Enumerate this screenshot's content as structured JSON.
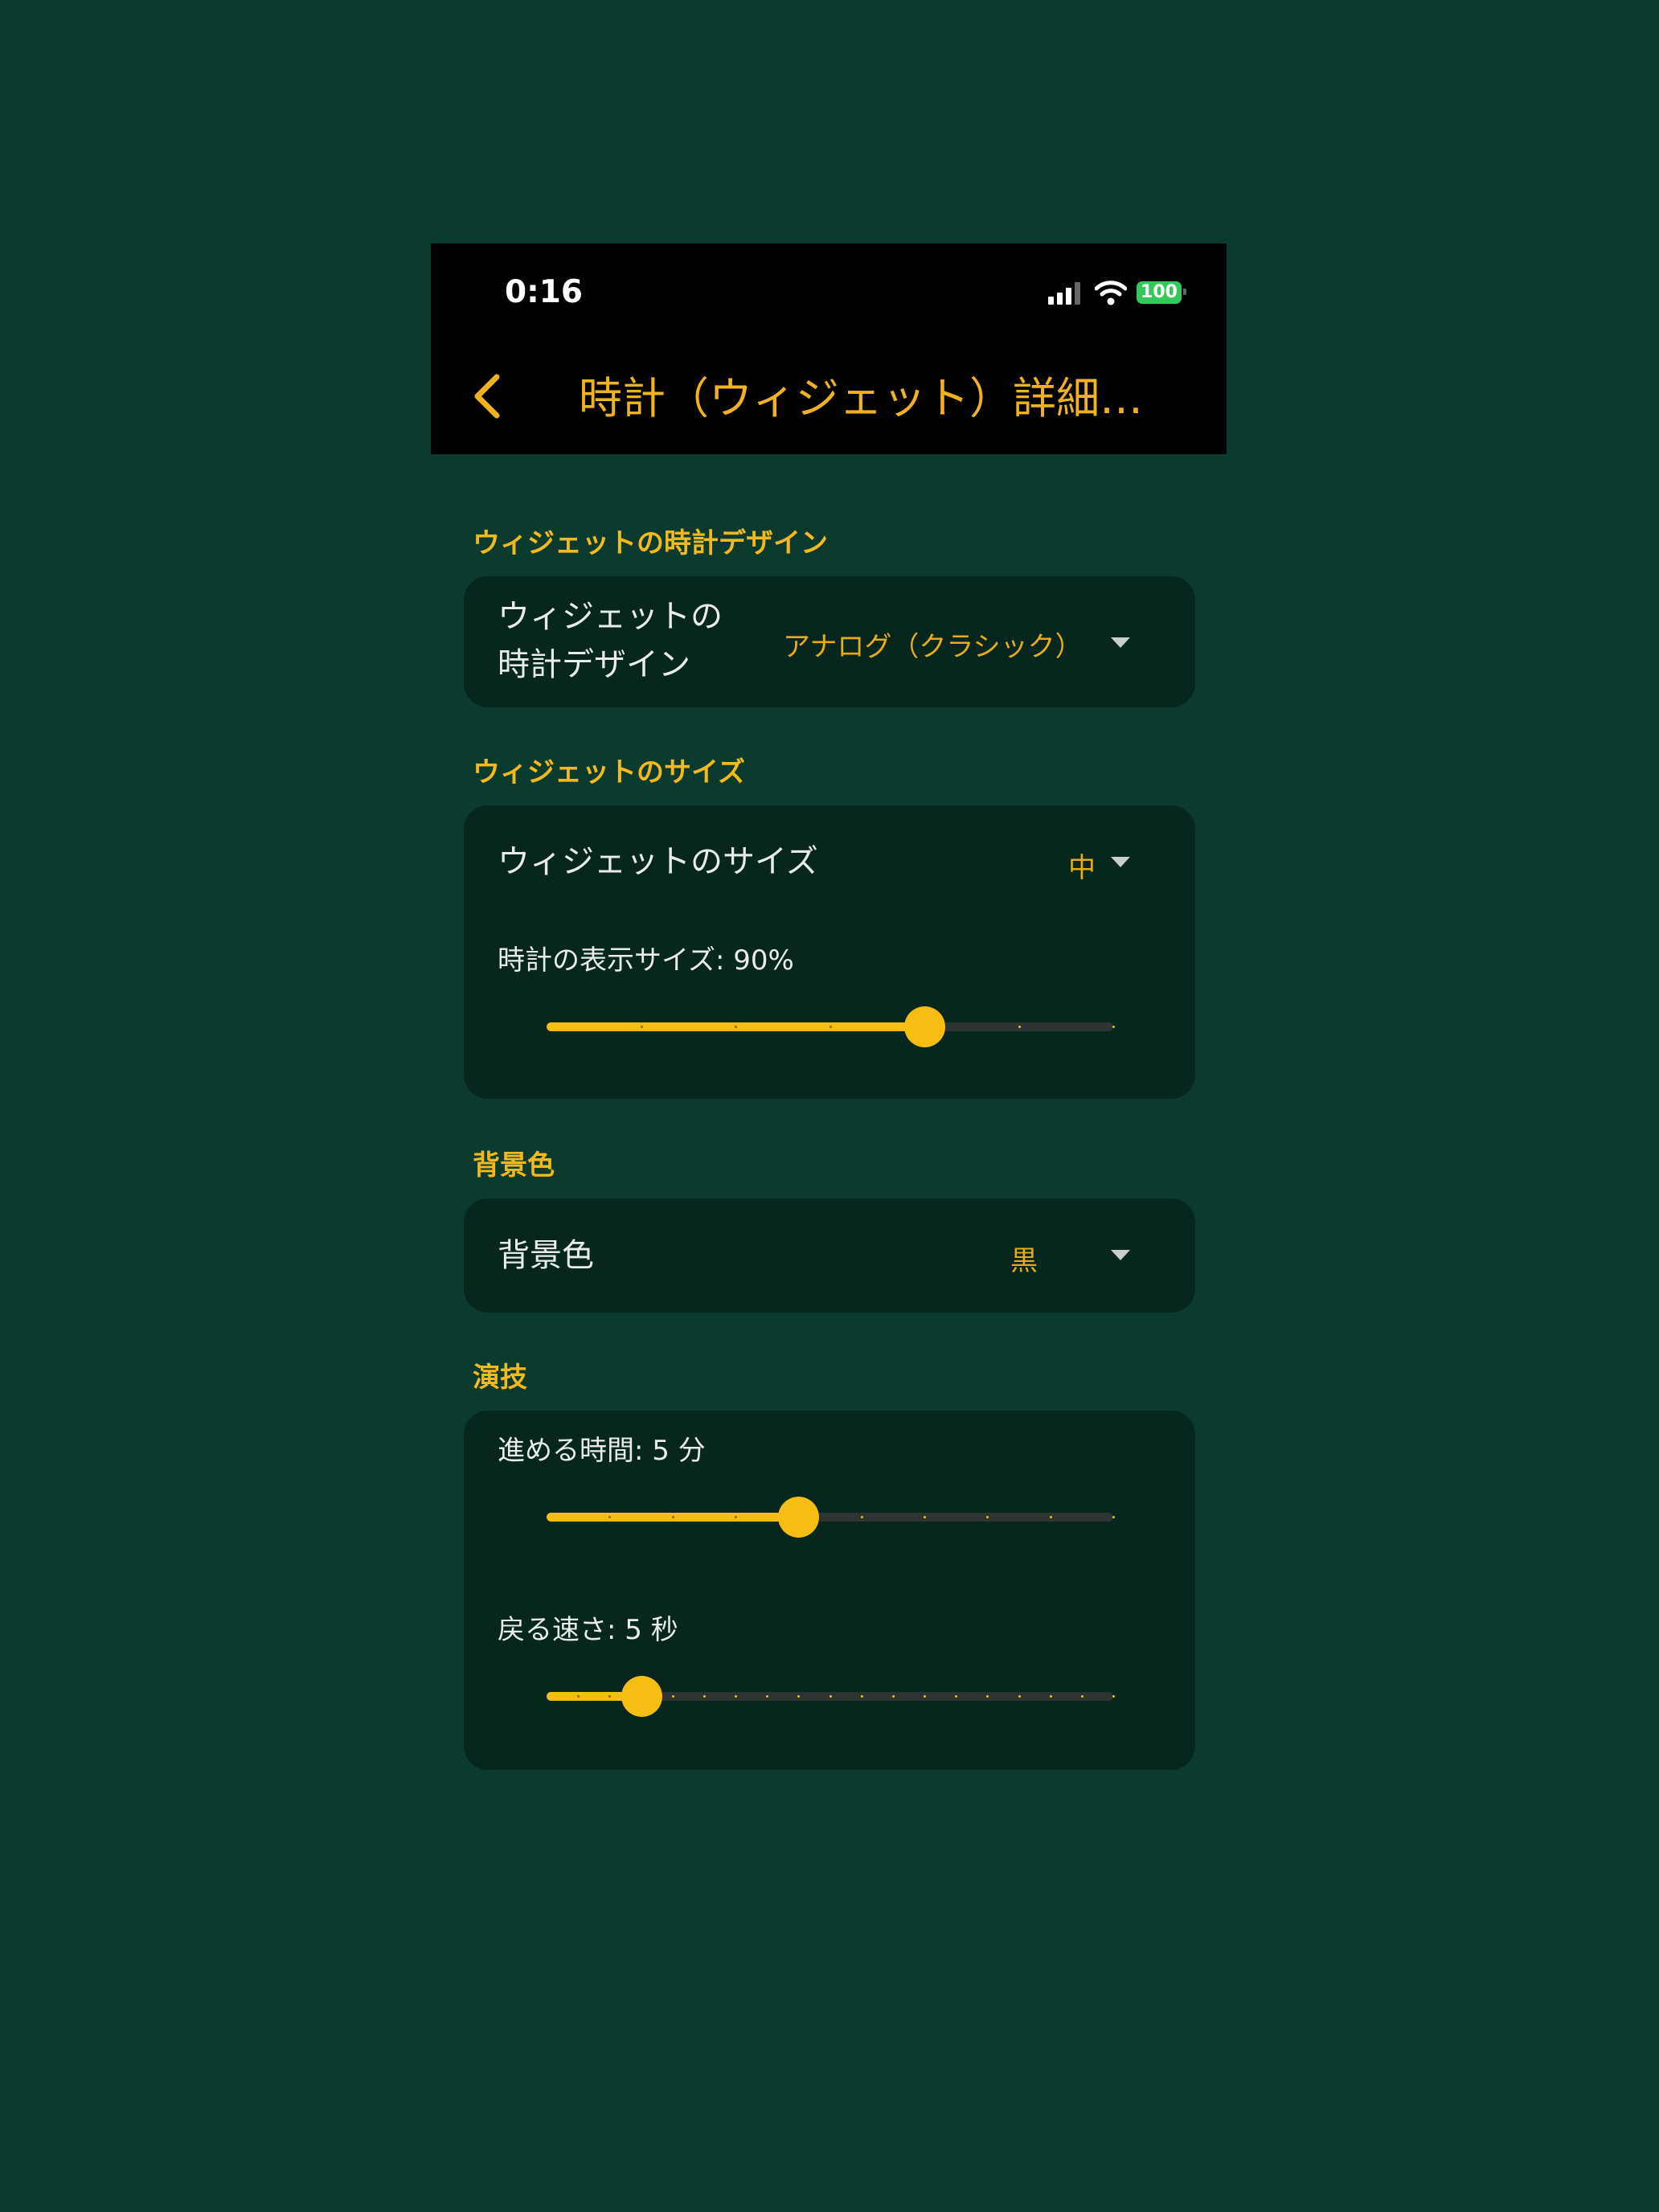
{
  "status_bar": {
    "time": "0:16",
    "battery": "100"
  },
  "nav": {
    "title": "時計（ウィジェット）詳細…",
    "back_icon": "chevron-left-icon"
  },
  "sections": {
    "design": {
      "title": "ウィジェットの時計デザイン",
      "label_line1": "ウィジェットの",
      "label_line2": "時計デザイン",
      "value": "アナログ（クラシック）"
    },
    "size": {
      "title": "ウィジェットのサイズ",
      "label": "ウィジェットのサイズ",
      "value": "中",
      "slider_label": "時計の表示サイズ: 90%",
      "slider": {
        "value": 0.667,
        "ticks": 6
      }
    },
    "background": {
      "title": "背景色",
      "label": "背景色",
      "value": "黒"
    },
    "performance": {
      "title": "演技",
      "advance_label": "進める時間: 5 分",
      "advance_slider": {
        "value": 0.444,
        "ticks": 9
      },
      "return_label": "戻る速さ: 5 秒",
      "return_slider": {
        "value": 0.167,
        "ticks": 18
      }
    }
  },
  "colors": {
    "accent": "#f6be13",
    "background": "#0b3a2e",
    "card": "#06261e",
    "header": "#000000"
  }
}
